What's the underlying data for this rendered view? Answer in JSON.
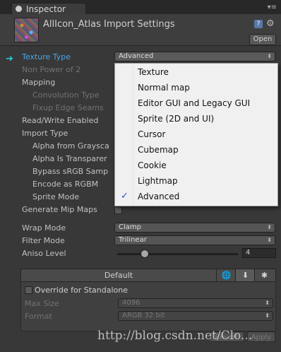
{
  "tab": {
    "label": "Inspector",
    "menu_glyph": "▾≡"
  },
  "header": {
    "title": "AllIcon_Atlas Import Settings",
    "open_label": "Open"
  },
  "fields": {
    "texture_type": {
      "label": "Texture Type",
      "value": "Advanced"
    },
    "non_power_of_2": "Non Power of 2",
    "mapping": "Mapping",
    "convolution_type": "Convolution Type",
    "fixup_edge_seams": "Fixup Edge Seams",
    "read_write_enabled": "Read/Write Enabled",
    "import_type": "Import Type",
    "alpha_from_grayscale": "Alpha from Graysca",
    "alpha_is_transparency": "Alpha Is Transparer",
    "bypass_srgb": "Bypass sRGB Samp",
    "encode_rgbm": "Encode as RGBM",
    "sprite_mode": "Sprite Mode",
    "generate_mip_maps": "Generate Mip Maps",
    "wrap_mode": {
      "label": "Wrap Mode",
      "value": "Clamp"
    },
    "filter_mode": {
      "label": "Filter Mode",
      "value": "Trilinear"
    },
    "aniso_level": {
      "label": "Aniso Level",
      "value": "4",
      "fraction": 0.2
    }
  },
  "dropdown": {
    "options": [
      "Texture",
      "Normal map",
      "Editor GUI and Legacy GUI",
      "Sprite (2D and UI)",
      "Cursor",
      "Cubemap",
      "Cookie",
      "Lightmap",
      "Advanced"
    ],
    "selected": "Advanced",
    "check_glyph": "✓"
  },
  "platforms": {
    "default_label": "Default"
  },
  "override": {
    "label": "Override for Standalone",
    "max_size": {
      "label": "Max Size",
      "value": "4096"
    },
    "format": {
      "label": "Format",
      "value": "ARGB 32 bit"
    }
  },
  "buttons": {
    "revert": "Revert",
    "apply": "Apply"
  },
  "watermark": "http://blog.csdn.net/Clo...",
  "colors": {
    "accent_arrow": "#24c8d0",
    "check": "#2858c8"
  }
}
